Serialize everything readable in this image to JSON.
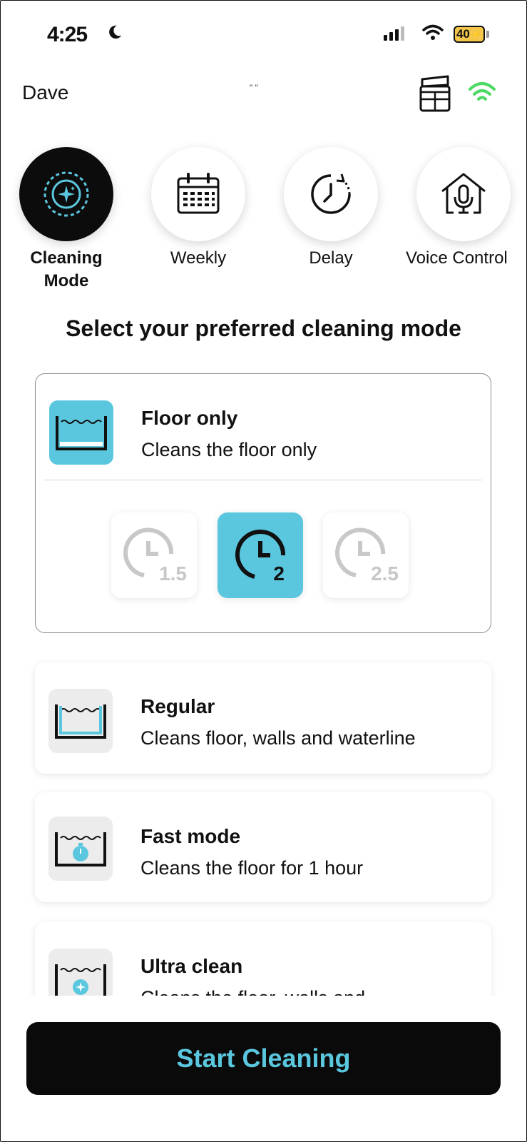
{
  "status_bar": {
    "time": "4:25",
    "battery": "40"
  },
  "header": {
    "user_name": "Dave",
    "center_text": "\" \""
  },
  "tabs": [
    {
      "label": "Cleaning Mode",
      "icon": "cleaning-mode-icon",
      "active": true
    },
    {
      "label": "Weekly",
      "icon": "calendar-icon",
      "active": false
    },
    {
      "label": "Delay",
      "icon": "delay-clock-icon",
      "active": false
    },
    {
      "label": "Voice Control",
      "icon": "voice-home-icon",
      "active": false
    }
  ],
  "section_title": "Select your preferred cleaning mode",
  "modes": [
    {
      "title": "Floor only",
      "description": "Cleans the floor only",
      "icon": "pool-floor-icon",
      "selected": true
    },
    {
      "title": "Regular",
      "description": "Cleans floor, walls and waterline",
      "icon": "pool-regular-icon",
      "selected": false
    },
    {
      "title": "Fast mode",
      "description": "Cleans the floor for 1 hour",
      "icon": "pool-fast-icon",
      "selected": false
    },
    {
      "title": "Ultra clean",
      "description": "Cleans the floor, walls and",
      "icon": "pool-ultra-icon",
      "selected": false
    }
  ],
  "durations": [
    {
      "label": "1.5",
      "selected": false
    },
    {
      "label": "2",
      "selected": true
    },
    {
      "label": "2.5",
      "selected": false
    }
  ],
  "start_button": "Start Cleaning",
  "colors": {
    "accent": "#5bc7df",
    "dark": "#0a0a0a",
    "wifi_green": "#4cd964"
  }
}
